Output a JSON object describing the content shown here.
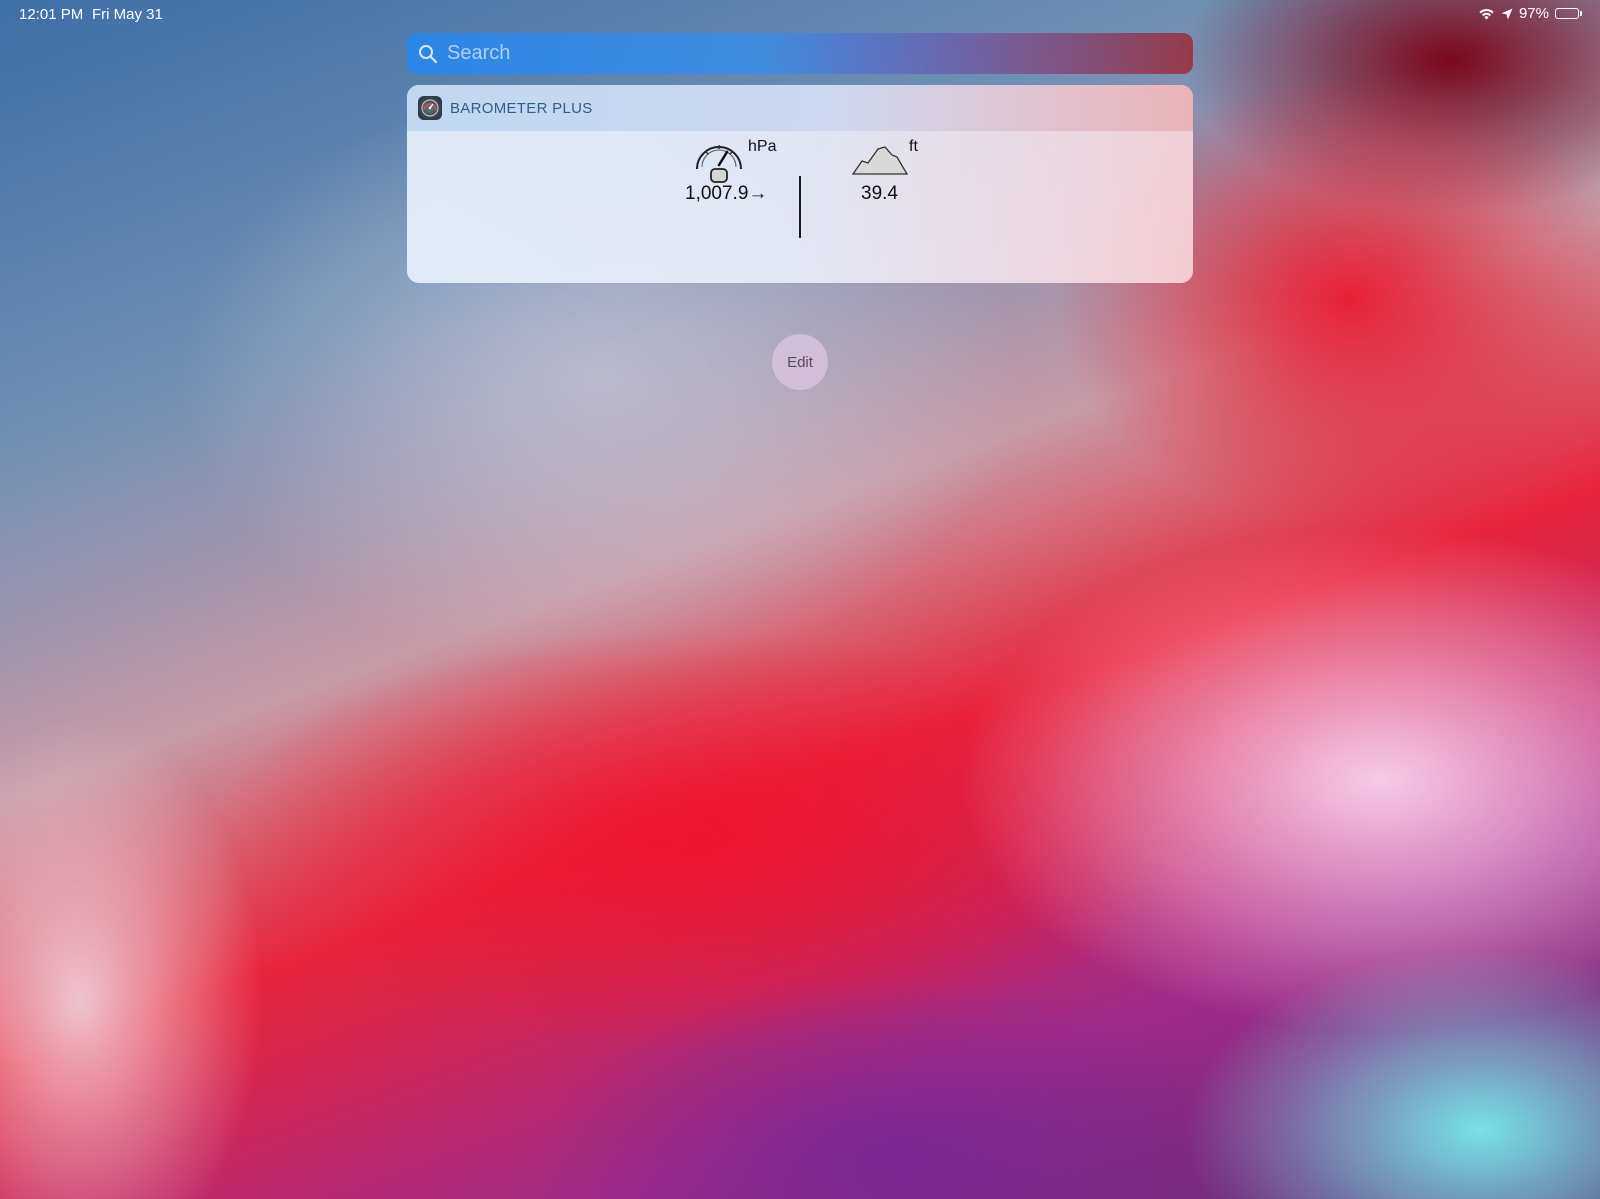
{
  "status_bar": {
    "time": "12:01 PM",
    "date": "Fri May 31",
    "battery_percent": "97%",
    "battery_level": 0.97,
    "icons": [
      "wifi-icon",
      "location-arrow-icon",
      "battery-icon"
    ]
  },
  "search": {
    "placeholder": "Search",
    "value": ""
  },
  "widget": {
    "title": "BAROMETER PLUS",
    "pressure": {
      "unit": "hPa",
      "value": "1,007.9→",
      "icon": "pressure-gauge-icon"
    },
    "altitude": {
      "unit": "ft",
      "value": "39.4",
      "icon": "mountain-icon"
    }
  },
  "edit_button": {
    "label": "Edit"
  },
  "colors": {
    "widget_title": "#2b5f8f",
    "search_bar_blue": "#2887eb",
    "text_dark": "#111111",
    "status_text": "#ffffff"
  }
}
